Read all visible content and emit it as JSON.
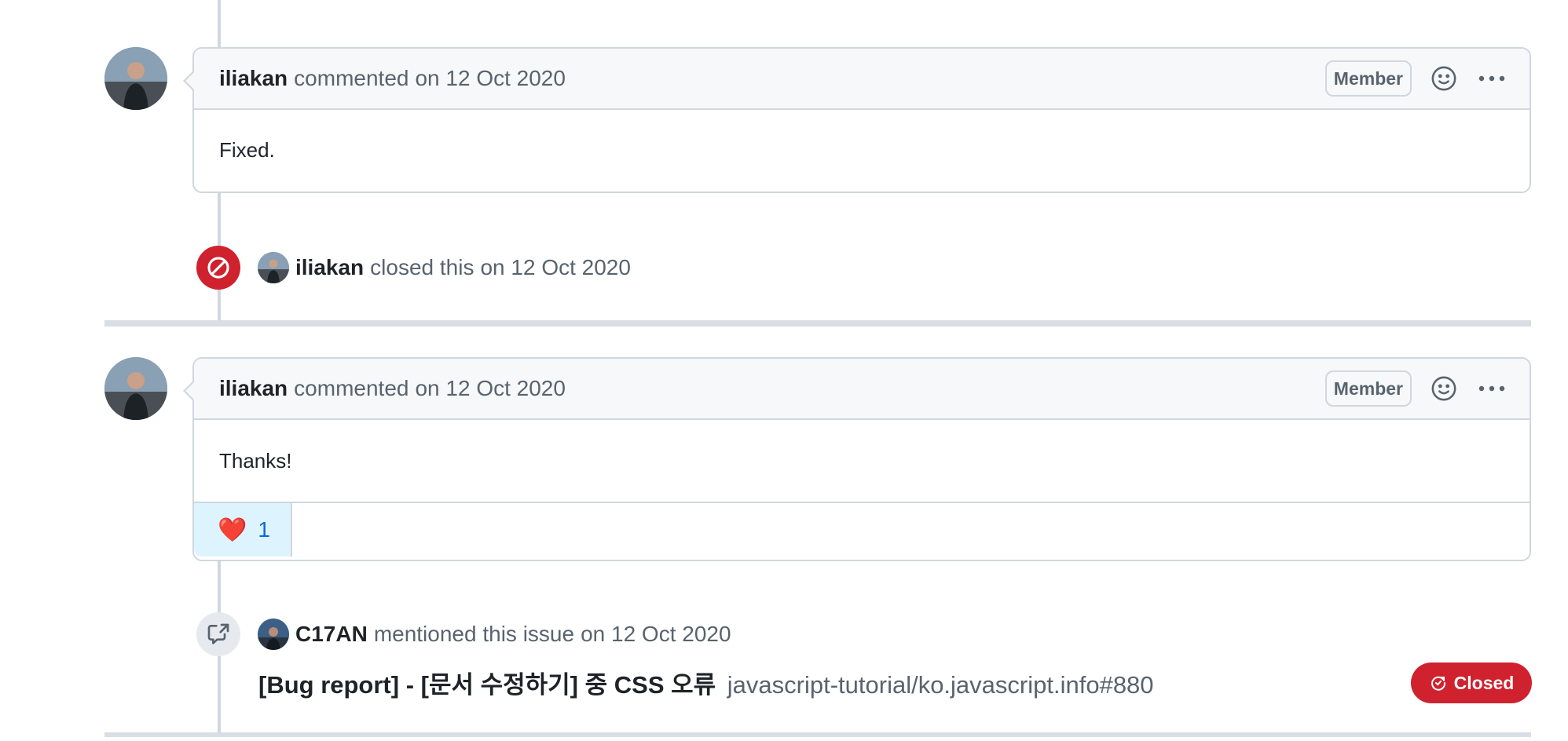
{
  "comments": [
    {
      "author": "iliakan",
      "action": "commented",
      "date": "on 12 Oct 2020",
      "badge": "Member",
      "body": "Fixed."
    },
    {
      "author": "iliakan",
      "action": "commented",
      "date": "on 12 Oct 2020",
      "badge": "Member",
      "body": "Thanks!",
      "reaction": {
        "emoji": "❤️",
        "count": "1"
      }
    }
  ],
  "events": {
    "closed": {
      "actor": "iliakan",
      "text": "closed this",
      "date": "on 12 Oct 2020"
    },
    "mentioned": {
      "actor": "C17AN",
      "text": "mentioned this issue",
      "date": "on 12 Oct 2020",
      "ref_title": "[Bug report] - [문서 수정하기] 중 CSS 오류",
      "ref_repo": "javascript-tutorial/ko.javascript.info#880",
      "state": "Closed"
    }
  },
  "colors": {
    "closed_red": "#cf222e",
    "reaction_bg": "#ddf4ff",
    "link_blue": "#0969da",
    "border": "#d0d7de"
  },
  "icons": [
    "smiley-icon",
    "kebab-horizontal-icon",
    "circle-slash-icon",
    "cross-reference-icon",
    "issue-closed-icon"
  ]
}
